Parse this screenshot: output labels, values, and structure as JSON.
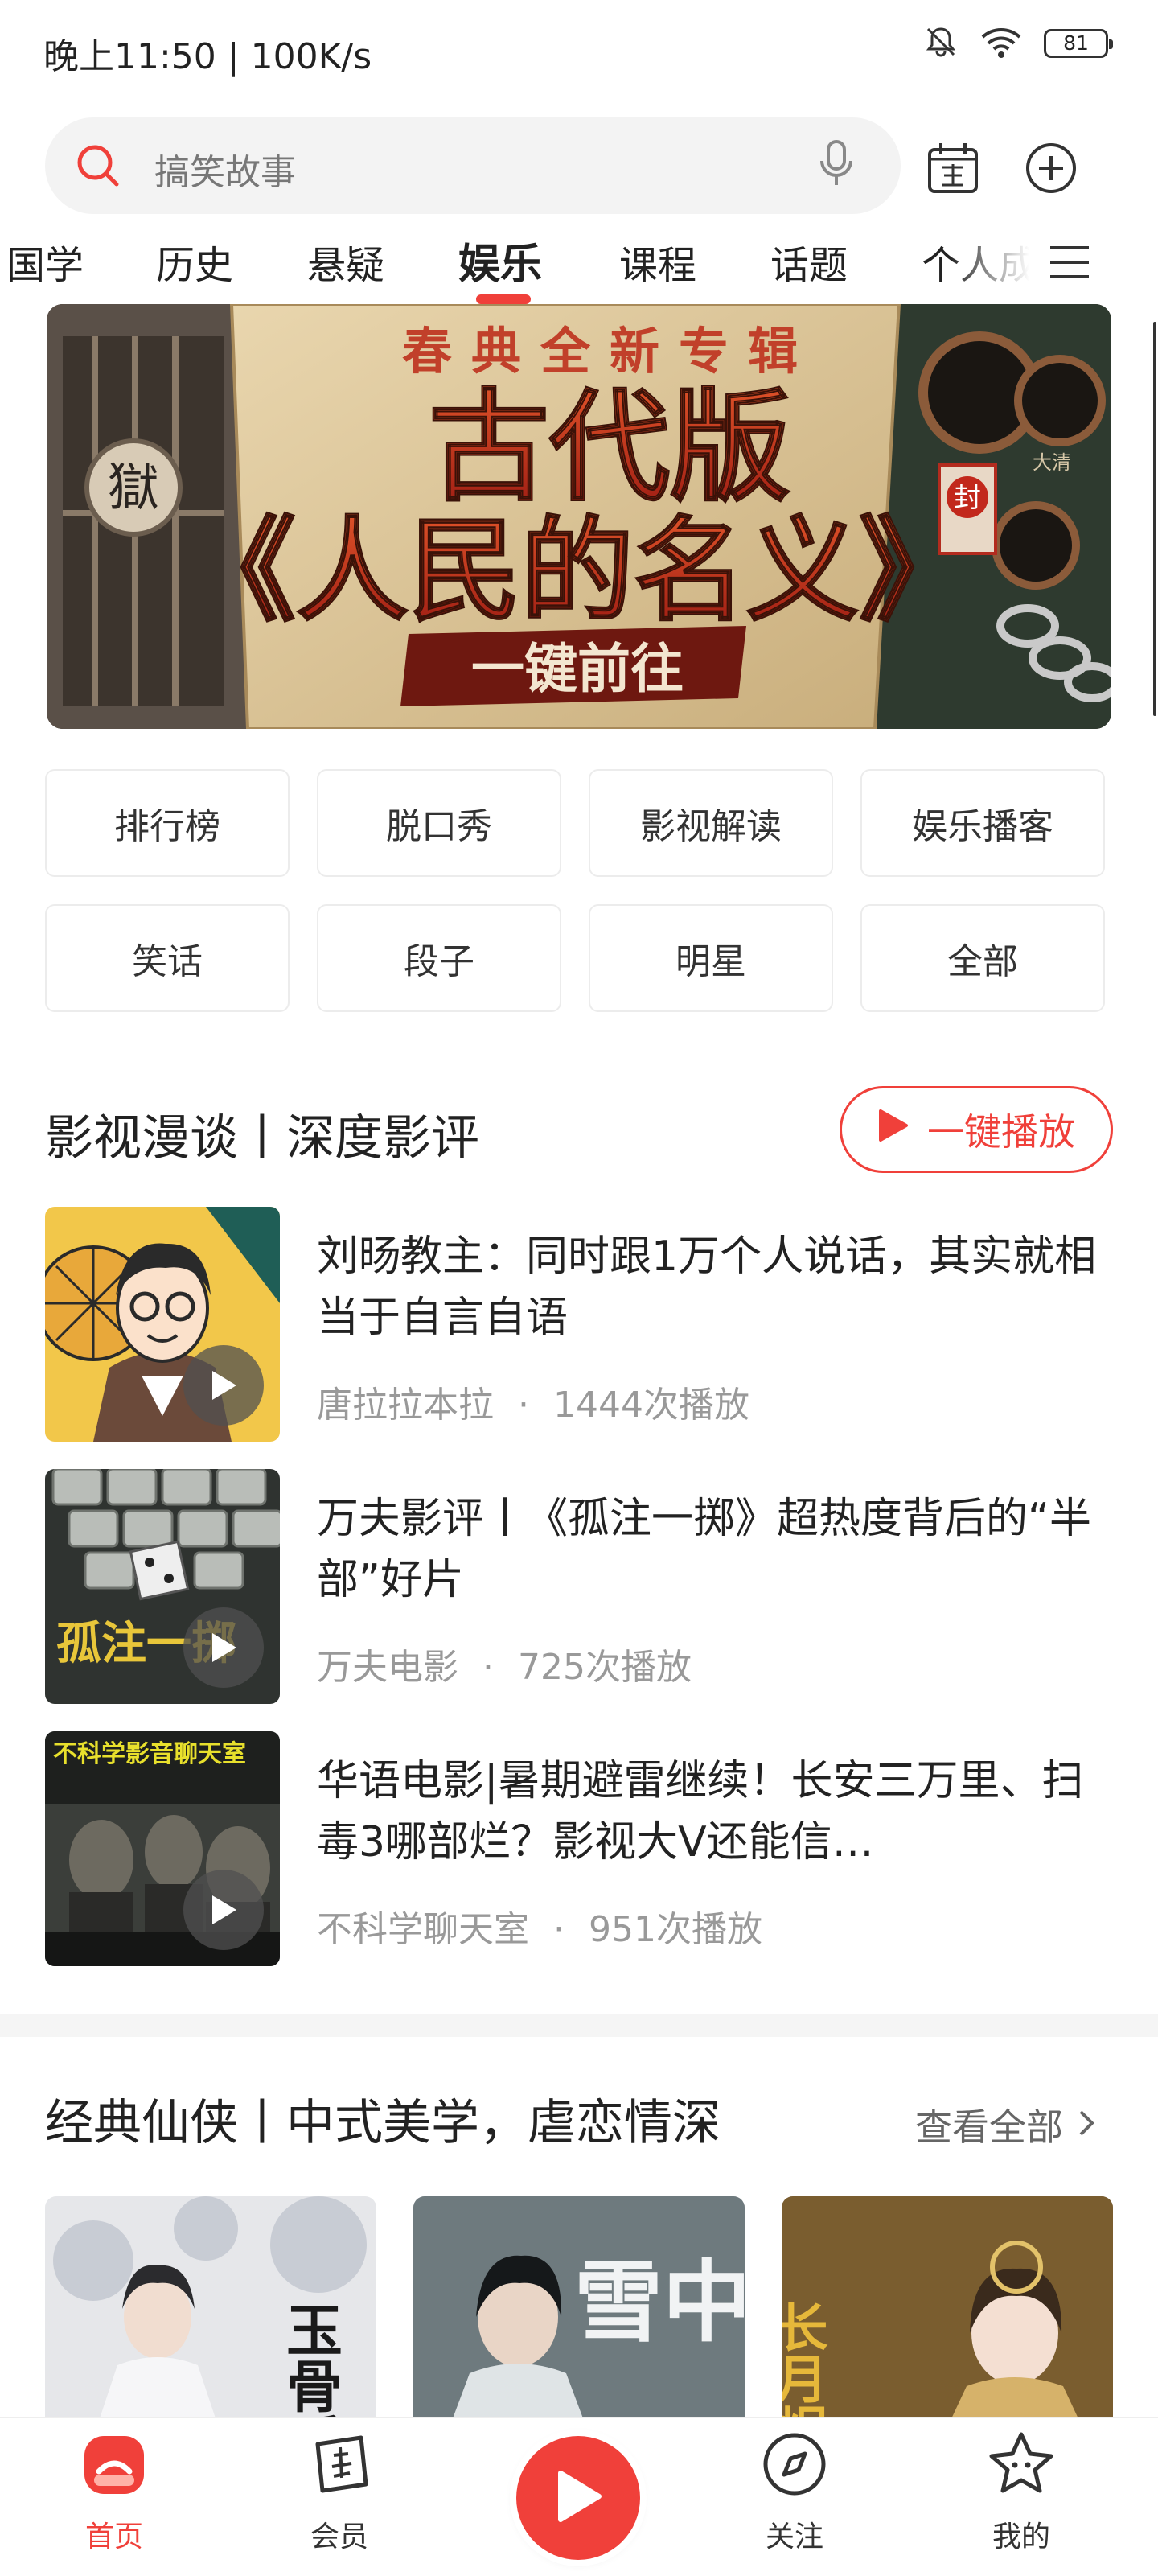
{
  "status_bar": {
    "time": "晚上11:50 | 100K/s",
    "battery": "81"
  },
  "search": {
    "placeholder": "搞笑故事"
  },
  "tabs": [
    "国学",
    "历史",
    "悬疑",
    "娱乐",
    "课程",
    "话题",
    "个人成长"
  ],
  "active_tab": "娱乐",
  "banner": {
    "line1": "春典全新专辑",
    "line2": "古代版",
    "line3": "《人民的名义》",
    "cta": "一键前往",
    "sign1": "獄",
    "sign2": "封",
    "sign3": "大清"
  },
  "categories": [
    "排行榜",
    "脱口秀",
    "影视解读",
    "娱乐播客",
    "笑话",
    "段子",
    "明星",
    "全部"
  ],
  "section1": {
    "title": "影视漫谈丨深度影评",
    "play_all": "一键播放",
    "items": [
      {
        "title": "刘旸教主：同时跟1万个人说话，其实就相当于自言自语",
        "author": "唐拉拉本拉",
        "plays": "1444次播放"
      },
      {
        "title": "万夫影评丨《孤注一掷》超热度背后的“半部”好片",
        "author": "万夫电影",
        "plays": "725次播放",
        "thumb_text": "孤注一掷"
      },
      {
        "title": "华语电影|暑期避雷继续！长安三万里、扫毒3哪部烂？影视大V还能信…",
        "author": "不科学聊天室",
        "plays": "951次播放",
        "thumb_text": "不科学影音聊天室"
      }
    ]
  },
  "section2": {
    "title": "经典仙侠丨中式美学，虐恋情深",
    "view_all": "查看全部",
    "cards": [
      {
        "text": "玉骨遥"
      },
      {
        "text": "雪中"
      },
      {
        "text": "长月烬明"
      }
    ]
  },
  "bottom_nav": [
    {
      "label": "首页",
      "active": true
    },
    {
      "label": "会员",
      "active": false
    },
    {
      "label": "关注",
      "active": false
    },
    {
      "label": "我的",
      "active": false
    }
  ],
  "colors": {
    "accent": "#f0403a",
    "text": "#222222",
    "muted": "#999999"
  }
}
